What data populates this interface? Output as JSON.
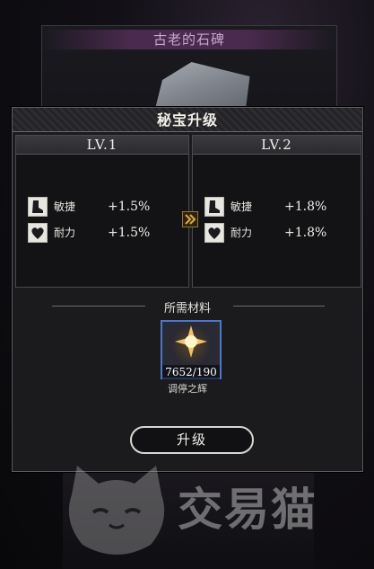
{
  "background": {
    "item_title": "古老的石碑"
  },
  "dialog": {
    "title": "秘宝升级",
    "current_level": {
      "label": "LV.1",
      "stats": [
        {
          "icon": "boot-icon",
          "name": "敏捷",
          "value": "+1.5%"
        },
        {
          "icon": "heart-icon",
          "name": "耐力",
          "value": "+1.5%"
        }
      ]
    },
    "next_level": {
      "label": "LV.2",
      "stats": [
        {
          "icon": "boot-icon",
          "name": "敏捷",
          "value": "+1.8%"
        },
        {
          "icon": "heart-icon",
          "name": "耐力",
          "value": "+1.8%"
        }
      ]
    },
    "materials": {
      "label": "所需材料",
      "items": [
        {
          "icon": "sun-gem-icon",
          "count": "7652/190",
          "name": "调停之辉"
        }
      ]
    },
    "upgrade_button": "升级"
  },
  "watermark": {
    "text": "交易猫"
  },
  "colors": {
    "accent_gold": "#d9a441",
    "slot_border": "#4f76c7",
    "panel_bg": "#1b1b1e"
  }
}
